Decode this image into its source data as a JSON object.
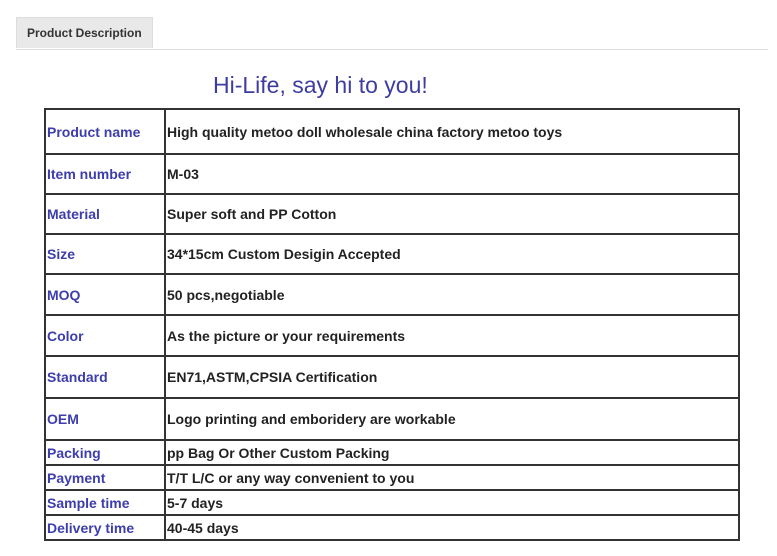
{
  "tabs": [
    {
      "label": "Product Description"
    }
  ],
  "headline": "Hi-Life, say hi to you!",
  "spec_rows": [
    {
      "label": "Product name",
      "value": "High quality metoo doll wholesale china factory metoo toys"
    },
    {
      "label": "Item number",
      "value": "M-03"
    },
    {
      "label": "Material",
      "value": "Super soft and PP Cotton"
    },
    {
      "label": "Size",
      "value": "34*15cm Custom Desigin Accepted"
    },
    {
      "label": "MOQ",
      "value": "50 pcs,negotiable"
    },
    {
      "label": "Color",
      "value": "As the picture or your requirements"
    },
    {
      "label": "Standard",
      "value": "EN71,ASTM,CPSIA Certification"
    },
    {
      "label": "OEM",
      "value": "Logo printing and emboridery are workable"
    },
    {
      "label": "Packing",
      "value": "pp Bag Or Other Custom Packing"
    },
    {
      "label": "Payment",
      "value": "T/T L/C or any way convenient to you"
    },
    {
      "label": "Sample time",
      "value": "5-7 days"
    },
    {
      "label": "Delivery time",
      "value": "40-45 days"
    }
  ],
  "colors": {
    "label_text": "#3d3dad",
    "headline_text": "#3d3da0",
    "value_text": "#222222",
    "border": "#333333"
  }
}
